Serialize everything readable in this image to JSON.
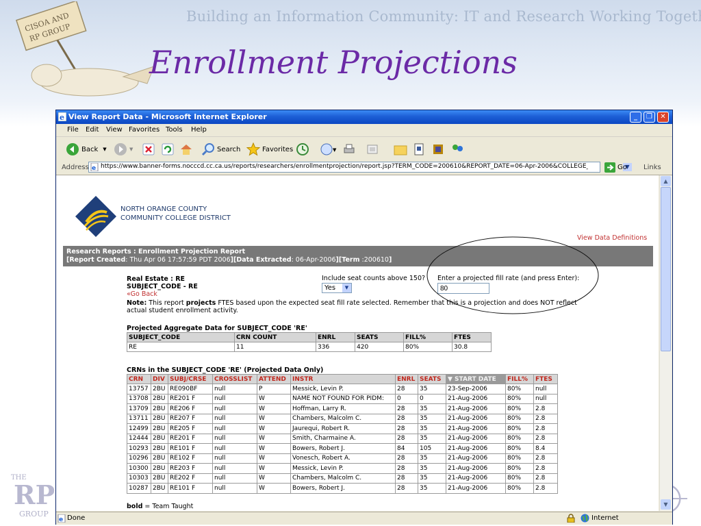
{
  "slide": {
    "tagline": "Building an Information Community:  IT and Research Working Together",
    "title": "Enrollment Projections",
    "mascot_sign": [
      "CISOA AND",
      "RP GROUP"
    ],
    "logo_the": "THE",
    "logo_rp": "RP",
    "logo_group": "GROUP"
  },
  "browser": {
    "title": "View Report Data - Microsoft Internet Explorer",
    "menu": [
      "File",
      "Edit",
      "View",
      "Favorites",
      "Tools",
      "Help"
    ],
    "toolbar": {
      "back": "Back",
      "search": "Search",
      "favorites": "Favorites"
    },
    "address_label": "Address",
    "address_url": "https://www.banner-forms.nocccd.cc.ca.us/reports/researchers/enrollmentprojection/report.jsp?TERM_CODE=200610&REPORT_DATE=06-Apr-2006&COLLEGE_CODE=",
    "go": "Go",
    "links": "Links",
    "status": "Done",
    "zone": "Internet",
    "icons": [
      "ie-icon",
      "back-icon",
      "forward-icon",
      "stop-icon",
      "refresh-icon",
      "home-icon",
      "search-icon",
      "star-icon",
      "history-icon",
      "mail-icon",
      "print-icon",
      "edit-icon",
      "folder-icon",
      "messenger-icon",
      "lock-icon",
      "globe-icon"
    ]
  },
  "page": {
    "district": [
      "NORTH ORANGE COUNTY",
      "COMMUNITY COLLEGE DISTRICT"
    ],
    "view_definitions": "View Data Definitions",
    "header_line1": "Research Reports : Enrollment Projection Report",
    "header_created_label": "Report Created",
    "header_created_value": ": Thu Apr 06 17:57:59 PDT 2006",
    "header_extracted_label": "Data Extracted",
    "header_extracted_value": ": 06-Apr-2006",
    "header_term_label": "Term",
    "header_term_value": " :200610",
    "real_estate": "Real Estate : RE",
    "subject_code": "SUBJECT_CODE - RE",
    "go_back": "«Go Back",
    "include_label": "Include seat counts above 150?",
    "include_value": "Yes",
    "fill_label": "Enter a projected fill rate (and press Enter):",
    "fill_value": "80",
    "note_label": "Note:",
    "note_text_1": " This report ",
    "note_bold": "projects",
    "note_text_2": " FTES based upon the expected seat fill rate selected. Remember that this is a projection and does NOT reflect actual student enrollment activity.",
    "agg_title": "Projected Aggregate Data for SUBJECT_CODE 'RE'",
    "agg_headers": [
      "SUBJECT_CODE",
      "CRN COUNT",
      "ENRL",
      "SEATS",
      "FILL%",
      "FTES"
    ],
    "agg_row": [
      "RE",
      "11",
      "336",
      "420",
      "80%",
      "30.8"
    ],
    "crn_title": "CRNs in the SUBJECT_CODE 'RE' (Projected Data Only)",
    "crn_headers": [
      "CRN",
      "DIV",
      "SUBJ/CRSE",
      "CROSSLIST",
      "ATTEND",
      "INSTR",
      "ENRL",
      "SEATS",
      "▼ START DATE",
      "FILL%",
      "FTES"
    ],
    "crn_rows": [
      [
        "13757",
        "2BU",
        "RE090BF",
        "null",
        "P",
        "Messick, Levin P.",
        "28",
        "35",
        "23-Sep-2006",
        "80%",
        "null"
      ],
      [
        "13708",
        "2BU",
        "RE201 F",
        "null",
        "W",
        "NAME NOT FOUND FOR PIDM:",
        "0",
        "0",
        "21-Aug-2006",
        "80%",
        "null"
      ],
      [
        "13709",
        "2BU",
        "RE206 F",
        "null",
        "W",
        "Hoffman, Larry R.",
        "28",
        "35",
        "21-Aug-2006",
        "80%",
        "2.8"
      ],
      [
        "13711",
        "2BU",
        "RE207 F",
        "null",
        "W",
        "Chambers, Malcolm C.",
        "28",
        "35",
        "21-Aug-2006",
        "80%",
        "2.8"
      ],
      [
        "12499",
        "2BU",
        "RE205 F",
        "null",
        "W",
        "Jaurequi, Robert R.",
        "28",
        "35",
        "21-Aug-2006",
        "80%",
        "2.8"
      ],
      [
        "12444",
        "2BU",
        "RE201 F",
        "null",
        "W",
        "Smith, Charmaine A.",
        "28",
        "35",
        "21-Aug-2006",
        "80%",
        "2.8"
      ],
      [
        "10293",
        "2BU",
        "RE101 F",
        "null",
        "W",
        "Bowers, Robert J.",
        "84",
        "105",
        "21-Aug-2006",
        "80%",
        "8.4"
      ],
      [
        "10296",
        "2BU",
        "RE102 F",
        "null",
        "W",
        "Vonesch, Robert A.",
        "28",
        "35",
        "21-Aug-2006",
        "80%",
        "2.8"
      ],
      [
        "10300",
        "2BU",
        "RE203 F",
        "null",
        "W",
        "Messick, Levin P.",
        "28",
        "35",
        "21-Aug-2006",
        "80%",
        "2.8"
      ],
      [
        "10303",
        "2BU",
        "RE202 F",
        "null",
        "W",
        "Chambers, Malcolm C.",
        "28",
        "35",
        "21-Aug-2006",
        "80%",
        "2.8"
      ],
      [
        "10287",
        "2BU",
        "RE101 F",
        "null",
        "W",
        "Bowers, Robert J.",
        "28",
        "35",
        "21-Aug-2006",
        "80%",
        "2.8"
      ]
    ],
    "legend_bold": "bold",
    "legend_text": " = Team Taught"
  },
  "colors": {
    "title_purple": "#6b2aa6",
    "xp_blue": "#0b47c2",
    "link_red": "#c03030",
    "header_gray": "#787878"
  }
}
